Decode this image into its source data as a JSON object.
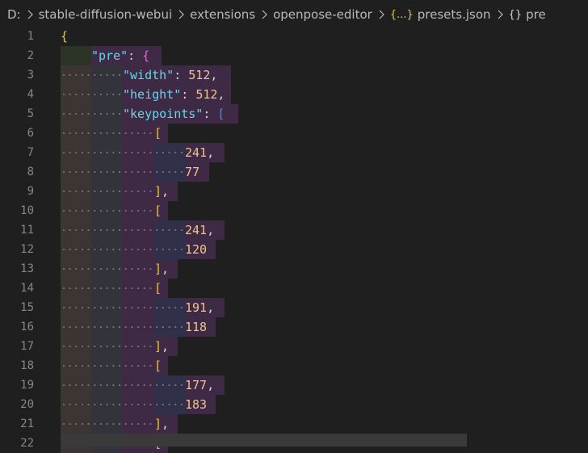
{
  "breadcrumb": {
    "drive": "D:",
    "seg1": "stable-diffusion-webui",
    "seg2": "extensions",
    "seg3": "openpose-editor",
    "file_icon": "{...}",
    "file": "presets.json",
    "symbol_icon": "{}",
    "symbol": "pre"
  },
  "editor": {
    "line_numbers": [
      "1",
      "2",
      "3",
      "4",
      "5",
      "6",
      "7",
      "8",
      "9",
      "10",
      "11",
      "12",
      "13",
      "14",
      "15",
      "16",
      "17",
      "18",
      "19",
      "20",
      "21",
      "22"
    ],
    "lines": {
      "l1_brace": "{",
      "l2_key": "\"pre\"",
      "l2_colon": ": ",
      "l2_brace": "{",
      "l3_key": "\"width\"",
      "l3_colon": ": ",
      "l3_val": "512",
      "l3_comma": ",",
      "l4_key": "\"height\"",
      "l4_colon": ": ",
      "l4_val": "512",
      "l4_comma": ",",
      "l5_key": "\"keypoints\"",
      "l5_colon": ": ",
      "l5_bracket": "[",
      "open_bracket": "[",
      "close_bracket": "]",
      "comma": ",",
      "l7_val": "241",
      "l8_val": "77",
      "l11_val": "241",
      "l12_val": "120",
      "l15_val": "191",
      "l16_val": "118",
      "l19_val": "177",
      "l20_val": "183",
      "l22_partial": "["
    }
  },
  "colors": {
    "background": "#1f1f1f",
    "key": "#62d7ea",
    "number": "#f3c389",
    "bracket_level1": "#f5c518",
    "bracket_level2": "#da70d6",
    "bracket_level3": "#179fff",
    "indent_rainbow_1": "#3d3434",
    "indent_rainbow_2": "#33333c",
    "indent_rainbow_3": "#3f2a45",
    "indent_rainbow_4": "#30304a"
  }
}
